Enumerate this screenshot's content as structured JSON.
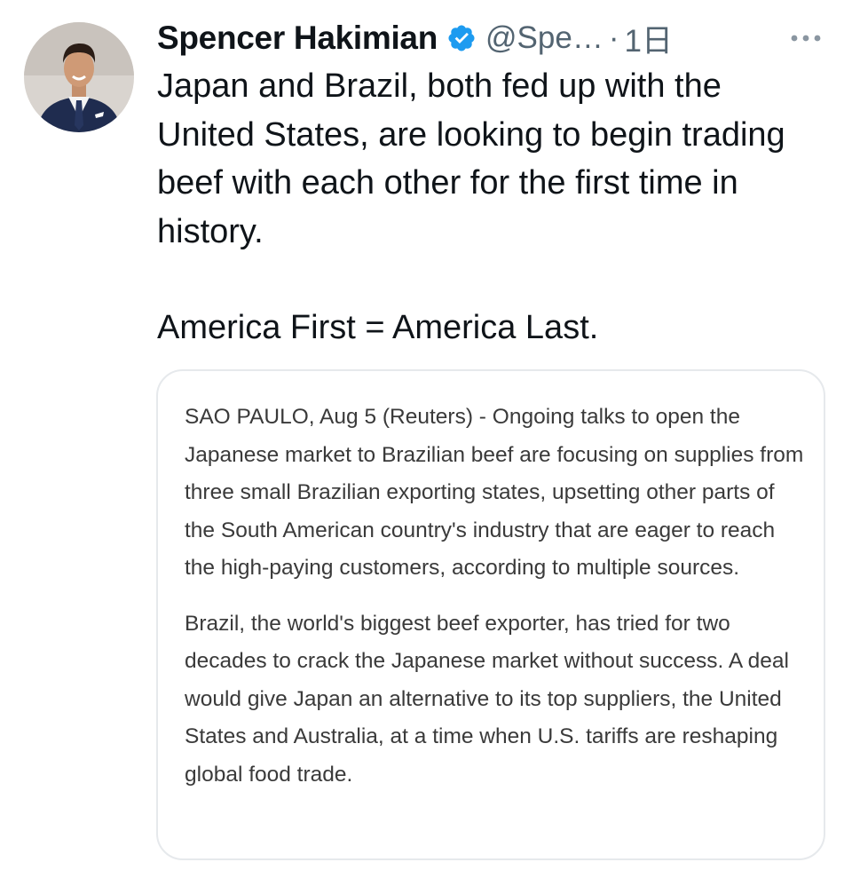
{
  "tweet": {
    "author_name": "Spencer Hakimian",
    "author_handle": "@Spe…",
    "separator": "·",
    "time": "1日",
    "verified_icon": "verified-badge-icon",
    "more_icon": "more-dots-icon",
    "text_line1": "Japan and Brazil, both fed up with the United States, are looking to begin trading beef with each other for the first time in history.",
    "text_line2": "America First = America Last."
  },
  "quote": {
    "paragraph1": "SAO PAULO, Aug 5 (Reuters) - Ongoing talks to open the Japanese market to Brazilian beef are focusing on supplies from three small Brazilian exporting states, upsetting other parts of the South American country's industry that are eager to reach the high-paying customers, according to multiple sources.",
    "paragraph2": "Brazil, the world's biggest beef exporter, has tried for two decades to crack the Japanese market without success. A deal would give Japan an alternative to its top suppliers, the United States and Australia, at a time when U.S. tariffs are reshaping global food trade."
  },
  "colors": {
    "verified_blue": "#1d9bf0",
    "secondary_text": "#536471",
    "card_border": "#e6e9ec"
  }
}
